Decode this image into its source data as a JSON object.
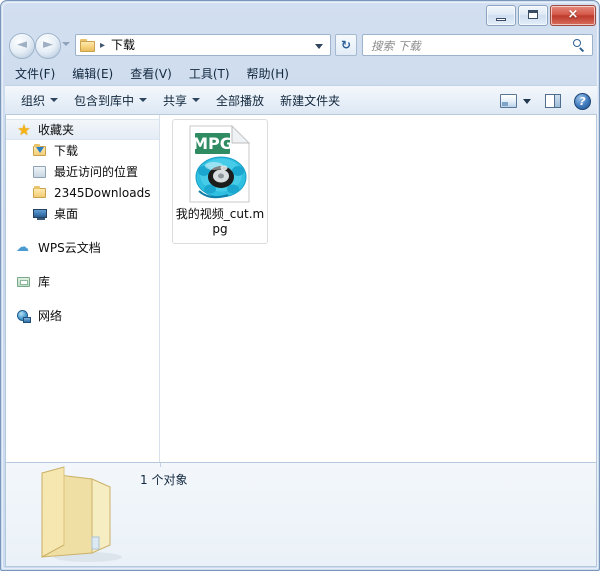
{
  "window": {
    "controls": {
      "minimize_label": "最小化",
      "maximize_label": "最大化",
      "close_label": "×"
    }
  },
  "address_bar": {
    "back_label": "◄",
    "forward_label": "►",
    "history_label": "历史记录",
    "folder_icon": "folder-icon",
    "separator": "▸",
    "crumb": "下载",
    "dropdown_label": "地址下拉",
    "refresh_label": "↻"
  },
  "search": {
    "placeholder": "搜索 下载",
    "value": "",
    "icon": "search-icon"
  },
  "menubar": {
    "items": [
      {
        "label": "文件(F)"
      },
      {
        "label": "编辑(E)"
      },
      {
        "label": "查看(V)"
      },
      {
        "label": "工具(T)"
      },
      {
        "label": "帮助(H)"
      }
    ]
  },
  "toolbar": {
    "items": [
      {
        "label": "组织",
        "has_caret": true
      },
      {
        "label": "包含到库中",
        "has_caret": true
      },
      {
        "label": "共享",
        "has_caret": true
      },
      {
        "label": "全部播放",
        "has_caret": false
      },
      {
        "label": "新建文件夹",
        "has_caret": false
      }
    ],
    "view_icon": "view-mode-icon",
    "view_dropdown": "view-mode-dropdown",
    "pane_icon": "preview-pane-icon",
    "help_icon": "help-icon",
    "help_glyph": "?"
  },
  "sidebar": {
    "items": [
      {
        "label": "收藏夹",
        "icon": "star-icon",
        "level": "header",
        "selected": true
      },
      {
        "label": "下载",
        "icon": "download-folder-icon",
        "level": "child",
        "selected": false
      },
      {
        "label": "最近访问的位置",
        "icon": "recent-places-icon",
        "level": "child",
        "selected": false
      },
      {
        "label": "2345Downloads",
        "icon": "folder-icon",
        "level": "child",
        "selected": false
      },
      {
        "label": "桌面",
        "icon": "desktop-icon",
        "level": "child",
        "selected": false
      },
      {
        "label": "WPS云文档",
        "icon": "cloud-icon",
        "level": "header",
        "selected": false
      },
      {
        "label": "库",
        "icon": "library-icon",
        "level": "header",
        "selected": false
      },
      {
        "label": "网络",
        "icon": "network-icon",
        "level": "header",
        "selected": false
      }
    ],
    "cloud_glyph": "☁",
    "star_glyph": "★"
  },
  "content": {
    "files": [
      {
        "name": "我的视频_cut.mpg",
        "type_label": "MPG",
        "icon": "mpg-file-icon",
        "selected": true
      }
    ]
  },
  "statusbar": {
    "folder_icon": "open-folder-icon",
    "text": "1 个对象"
  },
  "colors": {
    "window_frame": "#c8d8ec",
    "mpg_badge": "#2e8b62",
    "reel_blue": "#29b6dd",
    "close_button": "#bd3a2b",
    "accent_text": "#13293f"
  }
}
